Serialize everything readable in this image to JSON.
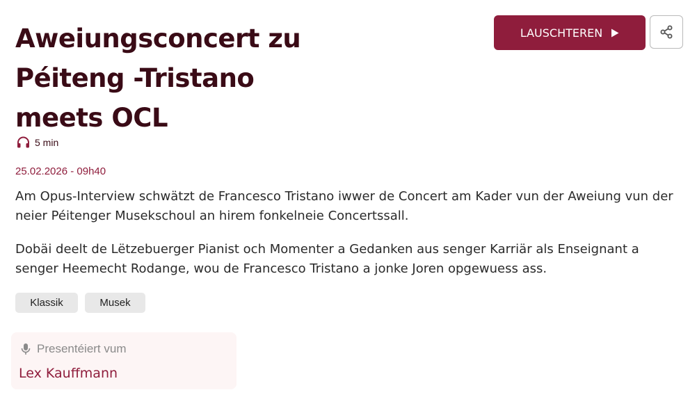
{
  "article": {
    "title_lines": [
      "Aweiungsconcert zu",
      "Péiteng -Tristano",
      "meets OCL"
    ],
    "duration": "5 min",
    "date": "25.02.2026 - 09h40",
    "paragraphs": [
      "Am Opus-Interview schwätzt de Francesco Tristano iwwer de Concert am Kader vun der Aweiung vun der neier Péitenger Musekschoul an hirem fonkelneie Concertssall.",
      "Dobäi deelt de Lëtzebuerger Pianist och Momenter a Gedanken aus senger Karriär als Enseignant a senger Heemecht Rodange, wou de Francesco Tristano a jonke Joren opgewuess ass."
    ],
    "tags": [
      "Klassik",
      "Musek"
    ]
  },
  "actions": {
    "listen_label": "LAUSCHTEREN",
    "listen_icon": "play-icon",
    "share_icon": "share-icon"
  },
  "presenter": {
    "label": "Presentéiert vum",
    "name": "Lex Kauffmann",
    "icon": "microphone-icon"
  },
  "colors": {
    "accent": "#8f1d3c",
    "title": "#3a0b16",
    "tag_bg": "#e8e8e8",
    "card_bg": "#fdf5f5"
  }
}
